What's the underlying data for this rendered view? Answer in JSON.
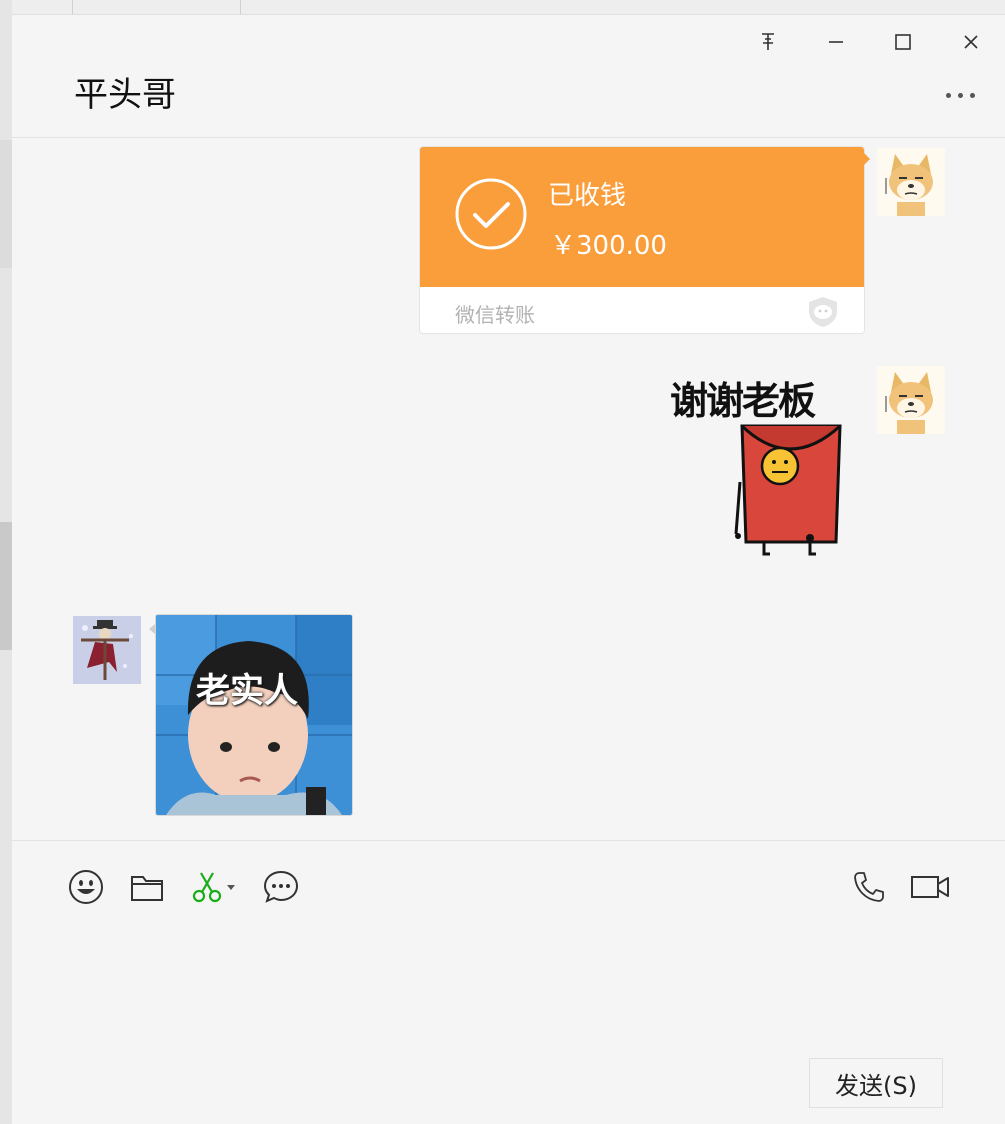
{
  "chat": {
    "title": "平头哥"
  },
  "messages": [
    {
      "type": "transfer",
      "side": "right",
      "status": "已收钱",
      "amount": "￥300.00",
      "source": "微信转账",
      "accent_color": "#fa9d3b"
    },
    {
      "type": "sticker",
      "side": "right",
      "text": "谢谢老板",
      "icon": "red-envelope-sticker"
    },
    {
      "type": "image",
      "side": "left",
      "caption": "老实人",
      "icon": "child-photo"
    }
  ],
  "toolbar": {
    "items": [
      "emoji-icon",
      "folder-icon",
      "scissors-icon",
      "chat-bubble-icon",
      "phone-icon",
      "video-icon"
    ],
    "accent_color": "#1aad19"
  },
  "input": {
    "send_label": "发送(S)"
  }
}
